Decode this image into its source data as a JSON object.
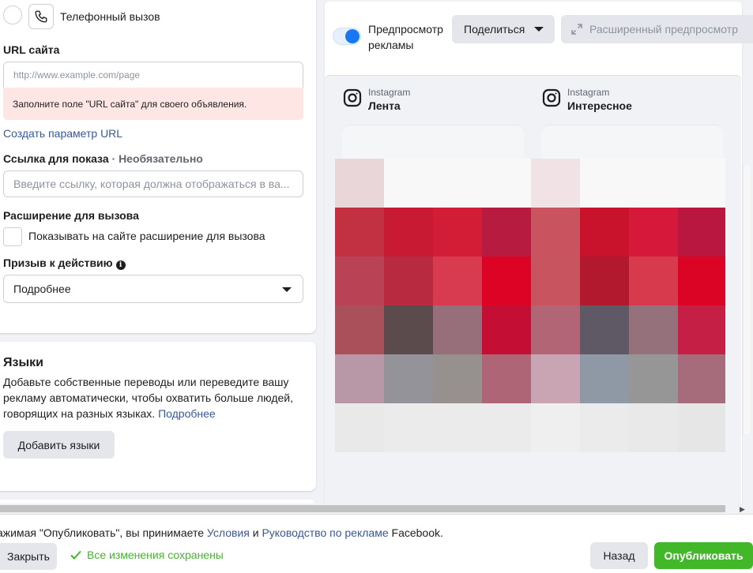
{
  "left": {
    "phone_call_label": "Телефонный вызов",
    "url_label": "URL сайта",
    "url_placeholder": "http://www.example.com/page",
    "url_error": "Заполните поле \"URL сайта\" для своего объявления.",
    "create_param_link": "Создать параметр URL",
    "display_link_label": "Ссылка для показа",
    "display_link_optional": "· Необязательно",
    "display_link_placeholder": "Введите ссылку, которая должна отображаться в ва...",
    "call_ext_label": "Расширение для вызова",
    "call_ext_checkbox_label": "Показывать на сайте расширение для вызова",
    "cta_label": "Призыв к действию",
    "cta_value": "Подробнее"
  },
  "languages": {
    "title": "Языки",
    "description": "Добавьте собственные переводы или переведите вашу рекламу автоматически, чтобы охватить больше людей, говорящих на разных языках.",
    "learn_more": "Подробнее",
    "add_button": "Добавить языки"
  },
  "preview": {
    "toggle_label_line1": "Предпросмотр",
    "toggle_label_line2": "рекламы",
    "toggle_on": true,
    "share_button": "Поделиться",
    "advanced_button": "Расширенный предпросмотр",
    "placements": [
      {
        "platform": "Instagram",
        "name": "Лента"
      },
      {
        "platform": "Instagram",
        "name": "Интересное"
      }
    ],
    "mosaic_colors": [
      "#e9d6d9",
      "#f8f8f8",
      "#f8f8f8",
      "#f8f8f8",
      "#f1e2e5",
      "#f8f8f8",
      "#f8f8f8",
      "#f8f8f8",
      "#c13141",
      "#c91a33",
      "#d31d36",
      "#b81b40",
      "#c9545f",
      "#c9122b",
      "#d6183a",
      "#b91740",
      "#b94255",
      "#b82a40",
      "#d83a50",
      "#dc0325",
      "#c8545f",
      "#b2192f",
      "#d83a4d",
      "#db0424",
      "#a9505b",
      "#5b4b4c",
      "#966f7a",
      "#c40e34",
      "#b26675",
      "#5e5964",
      "#95727b",
      "#c61f46",
      "#b897a6",
      "#939399",
      "#96918f",
      "#ae6575",
      "#c9a5b4",
      "#8f99a5",
      "#979696",
      "#a76c7b",
      "#e9e9e9",
      "#ebebeb",
      "#ebebeb",
      "#ebebeb",
      "#efefef",
      "#ebebeb",
      "#e9e9e9",
      "#e6e6e6"
    ]
  },
  "footer": {
    "legal_prefix": "ажимая \"Опубликовать\", вы принимаете ",
    "terms_link": "Условия",
    "and": " и ",
    "guidelines_link": "Руководство по рекламе",
    "legal_suffix": " Facebook.",
    "close_button": "Закрыть",
    "saved_status": "Все изменения сохранены",
    "back_button": "Назад",
    "publish_button": "Опубликовать"
  }
}
